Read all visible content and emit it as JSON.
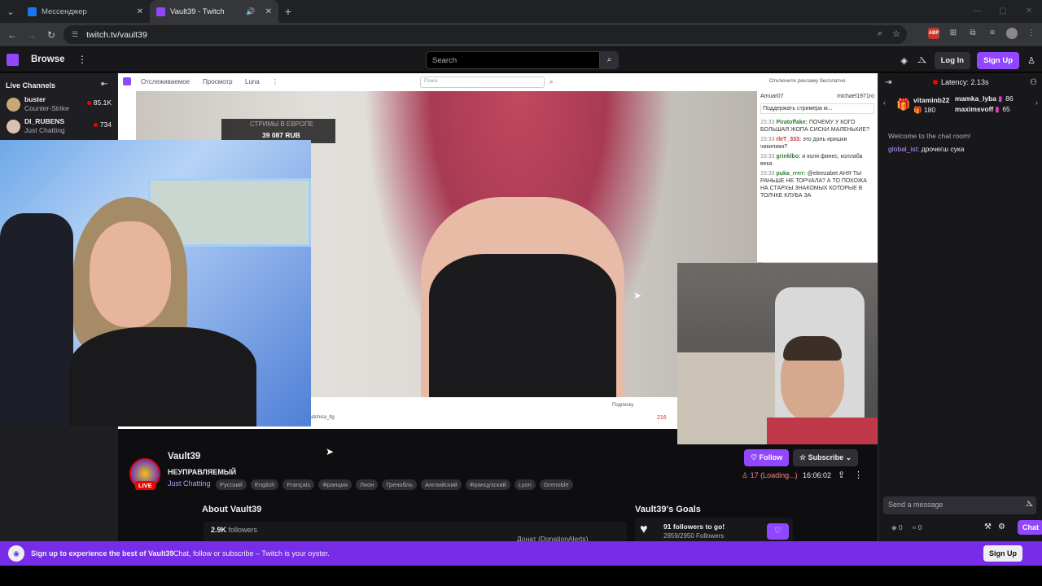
{
  "browser": {
    "tabs": [
      {
        "title": "Мессенджер",
        "active": false
      },
      {
        "title": "Vault39 - Twitch",
        "active": true
      }
    ],
    "url": "twitch.tv/vault39"
  },
  "twitch_nav": {
    "browse": "Browse",
    "search_placeholder": "Search",
    "login": "Log In",
    "signup": "Sign Up"
  },
  "sidebar": {
    "heading": "Live Channels",
    "channels": [
      {
        "name": "buster",
        "game": "Counter-Strike",
        "viewers": "85.1K"
      },
      {
        "name": "DI_RUBENS",
        "game": "Just Chatting",
        "viewers": "734"
      }
    ]
  },
  "inner_stream": {
    "nav": [
      "Отслеживаемое",
      "Просмотр",
      "Luna"
    ],
    "search_placeholder": "Поиск",
    "ads": "Отключите рекламу бесплатно",
    "donation_title": "СТРИМЫ В ЕВРОПЕ",
    "donation_amount": "39 087 RUB",
    "chat_header_left": "Amuar07",
    "chat_header_right": "michael1971ro",
    "chat_support": "Поддержать стримера м...",
    "chat_lines": [
      {
        "time": "15:33",
        "user": "Piratoffake:",
        "text": "ПОЧЕМУ У КОГО БОЛЬШАЯ ЖОПА СИСКИ МАЛЕНЬКИЕ?"
      },
      {
        "time": "15:33",
        "user": "rleT_333:",
        "text": "это доль иришки чикипики?"
      },
      {
        "time": "15:33",
        "user": "grinklbo:",
        "text": "и коля финес, коллаба века"
      },
      {
        "time": "15:33",
        "user": "puka_rrrrr:",
        "text": "@eleezabet АНЯ ТЫ РАНЬШЕ НЕ ТОРЧАЛА? А ТО ПОХОЖА НА СТАРХЫ ЗНАКОМЫХ КОТОРЫЕ В ТОЛЧКЕ КЛУБА ЗА"
      }
    ],
    "subscribe": "Подписку",
    "viewers": "216",
    "channel": "atchica_ltg"
  },
  "channel": {
    "name": "Vault39",
    "title": "НЕУПРАВЛЯЕМЫЙ",
    "category": "Just Chatting",
    "live": "LIVE",
    "tags": [
      "Русский",
      "English",
      "Français",
      "Франция",
      "Лион",
      "Гренобль",
      "Английский",
      "Французский",
      "Lyon",
      "Grenoble"
    ],
    "follow": "Follow",
    "subscribe": "Subscribe",
    "viewers": "17 (Loading...)",
    "uptime": "16:06:02",
    "about": "About Vault39",
    "followers_count": "2.9K",
    "followers_label": "followers",
    "donate_link": "Донат (DonationAlerts)",
    "goals_title": "Vault39's Goals",
    "goal_text": "91 followers to go!",
    "goal_progress": "2859/2950 Followers"
  },
  "chat": {
    "latency": "Latency: 2.13s",
    "leader_1_name": "vitaminb22",
    "leader_1_score": "180",
    "leader_2_name": "mamka_lyba",
    "leader_2_score": "86",
    "leader_3_name": "maximsvoff",
    "leader_3_score": "65",
    "welcome": "Welcome to the chat room!",
    "messages": [
      {
        "user": "global_ist",
        "text": "дрочегш сука"
      }
    ],
    "send_placeholder": "Send a message",
    "points_a": "0",
    "points_b": "0",
    "chat_button": "Chat"
  },
  "banner": {
    "bold": "Sign up to experience the best of Vault39",
    "text": "Chat, follow or subscribe – Twitch is your oyster.",
    "signup": "Sign Up"
  },
  "colors": {
    "accent": "#9147ff",
    "live": "#eb0400",
    "bg": "#0e0e10"
  }
}
